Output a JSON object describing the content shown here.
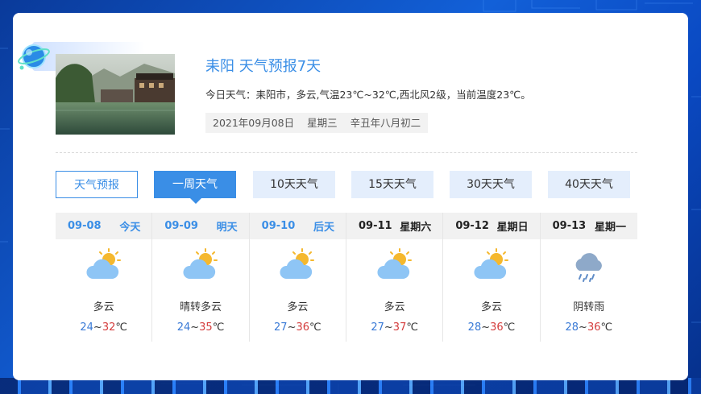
{
  "header": {
    "title": "耒阳 天气预报7天",
    "summary": "今日天气：耒阳市，多云,气温23℃~32℃,西北风2级，当前温度23℃。",
    "date": "2021年09月08日",
    "weekday": "星期三",
    "lunar": "辛丑年八月初二"
  },
  "tabs": [
    {
      "label": "天气预报"
    },
    {
      "label": "一周天气"
    },
    {
      "label": "10天天气"
    },
    {
      "label": "15天天气"
    },
    {
      "label": "30天天气"
    },
    {
      "label": "40天天气"
    }
  ],
  "active_tab": "一周天气",
  "days": [
    {
      "date": "09-08",
      "label": "今天",
      "condition": "多云",
      "low": "24",
      "sep": "~",
      "high": "32",
      "unit": "℃",
      "icon": "partly-cloudy-icon"
    },
    {
      "date": "09-09",
      "label": "明天",
      "condition": "晴转多云",
      "low": "24",
      "sep": "~",
      "high": "35",
      "unit": "℃",
      "icon": "partly-cloudy-icon"
    },
    {
      "date": "09-10",
      "label": "后天",
      "condition": "多云",
      "low": "27",
      "sep": "~",
      "high": "36",
      "unit": "℃",
      "icon": "partly-cloudy-icon"
    },
    {
      "date": "09-11",
      "label": "星期六",
      "condition": "多云",
      "low": "27",
      "sep": "~",
      "high": "37",
      "unit": "℃",
      "icon": "partly-cloudy-icon"
    },
    {
      "date": "09-12",
      "label": "星期日",
      "condition": "多云",
      "low": "28",
      "sep": "~",
      "high": "36",
      "unit": "℃",
      "icon": "partly-cloudy-icon"
    },
    {
      "date": "09-13",
      "label": "星期一",
      "condition": "阴转雨",
      "low": "28",
      "sep": "~",
      "high": "36",
      "unit": "℃",
      "icon": "rain-cloud-icon"
    }
  ],
  "colors": {
    "accent": "#3a8ee6",
    "low_temp": "#3a7ad6",
    "high_temp": "#d43c3c",
    "sun": "#f5b82e",
    "cloud": "#8ec5f5"
  }
}
